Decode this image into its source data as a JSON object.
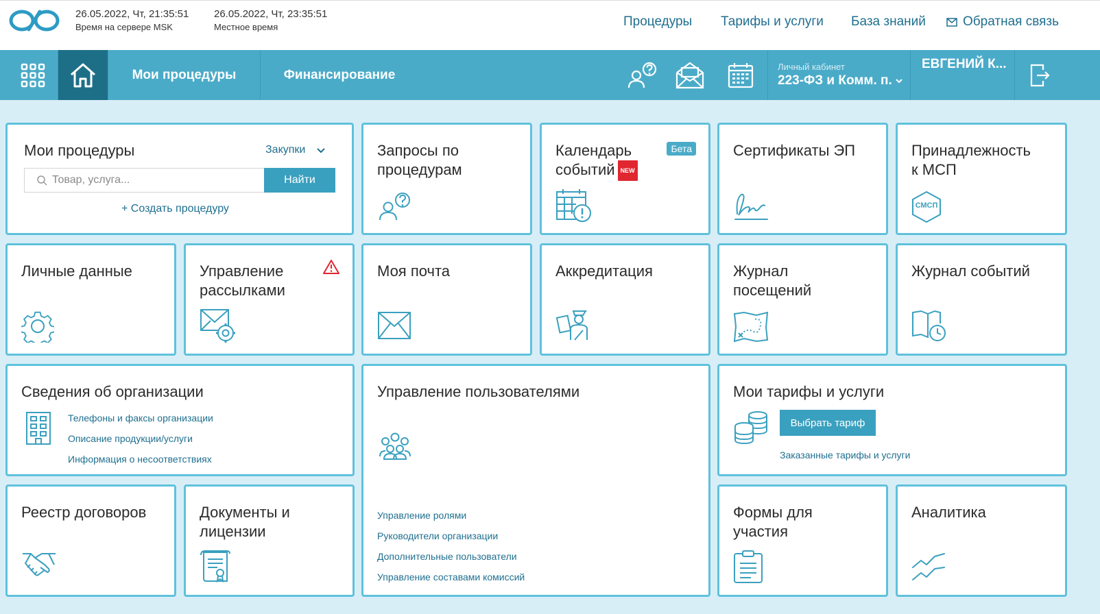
{
  "header": {
    "server_time": "26.05.2022, Чт, 21:35:51",
    "server_time_label": "Время на сервере MSK",
    "local_time": "26.05.2022, Чт, 23:35:51",
    "local_time_label": "Местное время",
    "nav": [
      "Процедуры",
      "Тарифы и услуги",
      "База знаний",
      "Обратная связь"
    ]
  },
  "navbar": {
    "my_procedures": "Мои процедуры",
    "financing": "Финансирование",
    "cabinet_label": "Личный кабинет",
    "cabinet_value": "223-ФЗ и Комм. п.",
    "user": "ЕВГЕНИЙ К..."
  },
  "tiles": {
    "procedures": {
      "title": "Мои процедуры",
      "dropdown": "Закупки",
      "search_placeholder": "Товар, услуга...",
      "search_button": "Найти",
      "create_link": "+ Создать процедуру"
    },
    "requests": {
      "title_l1": "Запросы по",
      "title_l2": "процедурам"
    },
    "calendar": {
      "title_l1": "Календарь",
      "title_l2": "событий",
      "badge_new": "NEW",
      "badge_beta": "Бета"
    },
    "certificates": {
      "title": "Сертификаты ЭП"
    },
    "msp": {
      "title_l1": "Принадлежность",
      "title_l2": "к МСП",
      "icon_text": "СМСП"
    },
    "personal": {
      "title": "Личные данные"
    },
    "mailing": {
      "title_l1": "Управление",
      "title_l2": "рассылками"
    },
    "mail": {
      "title": "Моя почта"
    },
    "accreditation": {
      "title": "Аккредитация"
    },
    "visits": {
      "title_l1": "Журнал",
      "title_l2": "посещений"
    },
    "events": {
      "title": "Журнал событий"
    },
    "org": {
      "title": "Сведения об организации",
      "links": [
        "Телефоны и факсы организации",
        "Описание продукции/услуги",
        "Информация о несоответствиях"
      ]
    },
    "users": {
      "title": "Управление пользователями",
      "links": [
        "Управление ролями",
        "Руководители организации",
        "Дополнительные пользователи",
        "Управление составами комиссий"
      ]
    },
    "tariffs": {
      "title": "Мои тарифы и услуги",
      "button": "Выбрать тариф",
      "link": "Заказанные тарифы и услуги"
    },
    "contracts": {
      "title": "Реестр договоров"
    },
    "documents": {
      "title_l1": "Документы и",
      "title_l2": "лицензии"
    },
    "forms": {
      "title_l1": "Формы для",
      "title_l2": "участия"
    },
    "analytics": {
      "title": "Аналитика"
    }
  },
  "colors": {
    "accent": "#4aabc8",
    "accent_dark": "#1d6f87",
    "tile_border": "#5fc1dc",
    "background": "#d8eef7",
    "badge_new": "#e0262f"
  },
  "icons": [
    "logo-icon",
    "apps-grid-icon",
    "home-icon",
    "mail-envelope-icon",
    "user-question-icon",
    "mail-open-icon",
    "calendar-icon",
    "chevron-down-icon",
    "logout-icon",
    "search-icon",
    "calendar-alert-icon",
    "signature-icon",
    "hexagon-icon",
    "gear-icon",
    "mail-gear-icon",
    "warning-icon",
    "envelope-icon",
    "officer-icon",
    "map-icon",
    "book-clock-icon",
    "building-icon",
    "group-icon",
    "coins-icon",
    "handshake-icon",
    "scroll-certificate-icon",
    "clipboard-icon",
    "trend-icon"
  ]
}
